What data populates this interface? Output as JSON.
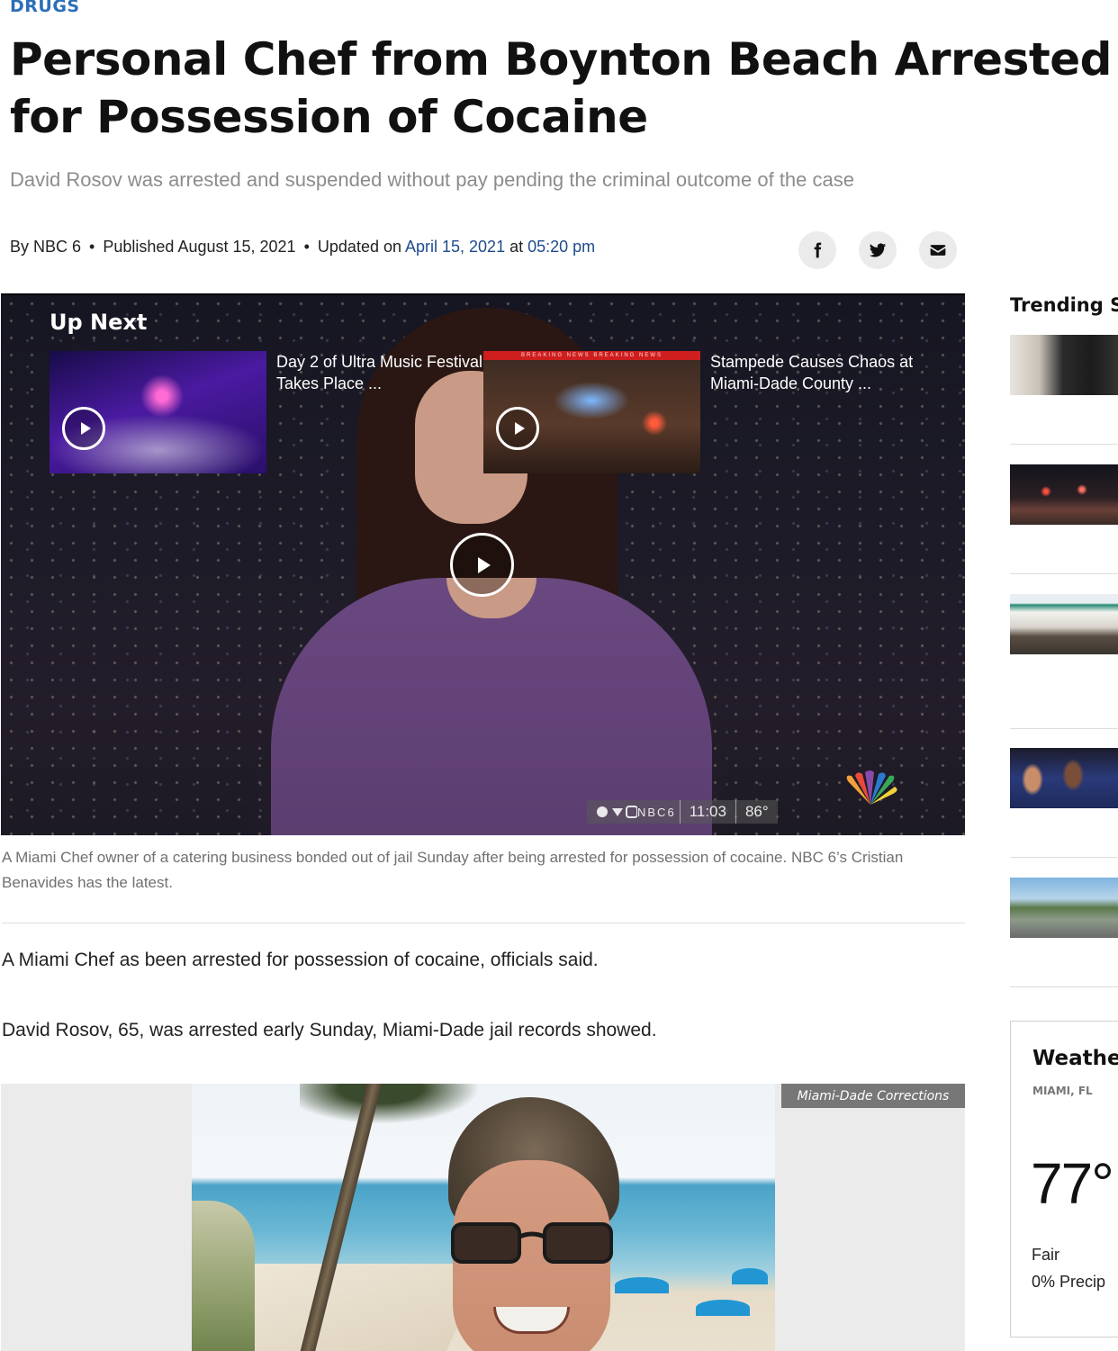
{
  "article": {
    "category": "DRUGS",
    "headline": "Personal Chef from Boynton Beach Arrested for Possession of Cocaine",
    "subhead": "David Rosov was arrested and suspended without pay pending the criminal outcome of the case",
    "byline": {
      "by": "By NBC 6",
      "published_prefix": "Published",
      "published_date": "August 15, 2021",
      "updated_prefix": "Updated on",
      "updated_date": "April 15, 2021",
      "at": "at",
      "updated_time": "05:20 pm",
      "separator": "•"
    },
    "share": {
      "facebook_icon": "facebook-icon",
      "twitter_icon": "twitter-icon",
      "email_icon": "email-icon"
    },
    "video": {
      "up_next_label": "Up Next",
      "up_next": [
        {
          "title": "Day 2 of Ultra Music Festival Takes Place ..."
        },
        {
          "title": "Stampede Causes Chaos at Miami-Dade County ...",
          "banner": "BREAKING NEWS  BREAKING NEWS"
        }
      ],
      "ticker": {
        "social": "NBC6",
        "time": "11:03",
        "temp": "86°"
      }
    },
    "caption": "A Miami Chef owner of a catering business bonded out of jail Sunday after being arrested for possession of cocaine. NBC 6’s Cristian Benavides has the latest.",
    "paragraphs": [
      "A Miami Chef as been arrested for possession of cocaine, officials said.",
      "David Rosov, 65, was arrested early Sunday, Miami-Dade jail records showed."
    ],
    "photo_credit": "Miami-Dade Corrections"
  },
  "sidebar": {
    "trending_title": "Trending St",
    "weather": {
      "title": "Weather",
      "location": "MIAMI, FL",
      "temperature": "77°",
      "condition": "Fair",
      "precip": "0% Precip"
    }
  },
  "colors": {
    "category_blue": "#2c6fb7",
    "link_blue": "#1f4b8c",
    "subhead_gray": "#8c8c8c",
    "credit_gray": "#777777"
  }
}
